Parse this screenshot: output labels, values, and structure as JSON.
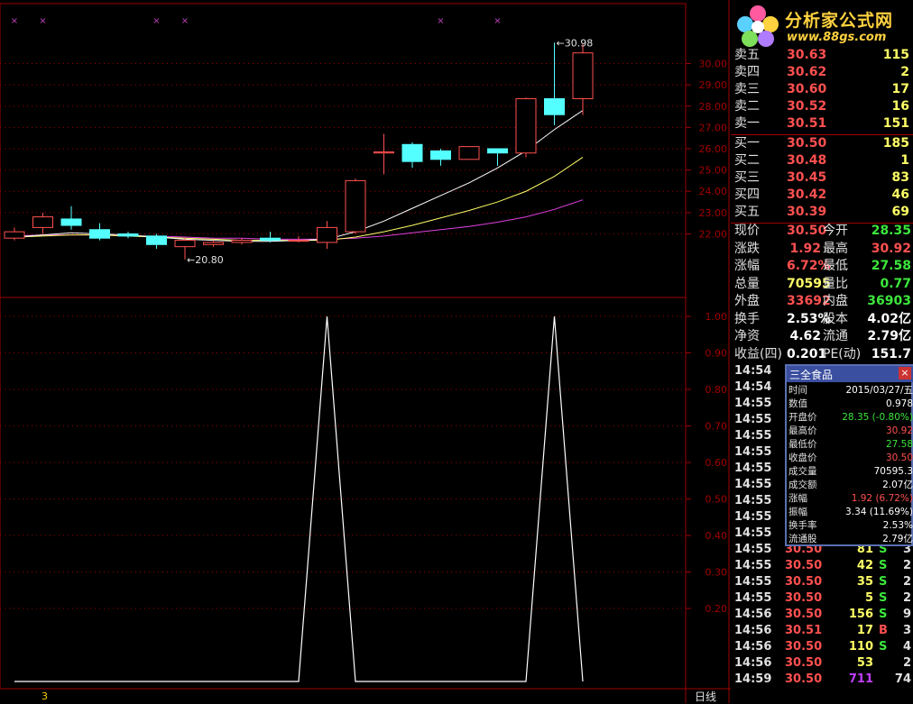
{
  "logo": {
    "title": "分析家公式网",
    "url": "www.88gs.com"
  },
  "colors": {
    "up": "#ff5050",
    "down": "#54ffff",
    "ma5": "#ffffff",
    "ma10": "#ffff66",
    "ma20": "#e040e0",
    "grid": "#a00000",
    "indicator": "#ffffff"
  },
  "chart_data": [
    {
      "type": "candlestick",
      "y_ticks": [
        "30.00",
        "29.00",
        "28.00",
        "27.00",
        "26.00",
        "25.00",
        "24.00",
        "23.00",
        "22.00"
      ],
      "ylim": [
        20.2,
        31.8
      ],
      "annotations": [
        {
          "label": "30.98",
          "x_index": 19,
          "y": 30.98
        },
        {
          "label": "20.80",
          "x_index": 6,
          "y": 20.8
        }
      ],
      "candles": [
        {
          "o": 21.8,
          "h": 22.3,
          "l": 21.7,
          "c": 22.1
        },
        {
          "o": 22.3,
          "h": 23.0,
          "l": 22.0,
          "c": 22.8
        },
        {
          "o": 22.7,
          "h": 23.3,
          "l": 22.2,
          "c": 22.4
        },
        {
          "o": 22.2,
          "h": 22.5,
          "l": 21.7,
          "c": 21.8
        },
        {
          "o": 22.0,
          "h": 22.1,
          "l": 21.8,
          "c": 21.9
        },
        {
          "o": 21.9,
          "h": 22.0,
          "l": 21.3,
          "c": 21.5
        },
        {
          "o": 21.4,
          "h": 21.8,
          "l": 20.8,
          "c": 21.7
        },
        {
          "o": 21.5,
          "h": 21.7,
          "l": 21.4,
          "c": 21.6
        },
        {
          "o": 21.6,
          "h": 21.8,
          "l": 21.5,
          "c": 21.7
        },
        {
          "o": 21.8,
          "h": 22.1,
          "l": 21.6,
          "c": 21.7
        },
        {
          "o": 21.7,
          "h": 21.9,
          "l": 21.6,
          "c": 21.7
        },
        {
          "o": 21.6,
          "h": 22.6,
          "l": 21.3,
          "c": 22.3
        },
        {
          "o": 22.1,
          "h": 24.6,
          "l": 22.0,
          "c": 24.5
        },
        {
          "o": 25.8,
          "h": 26.7,
          "l": 24.8,
          "c": 25.85
        },
        {
          "o": 26.2,
          "h": 26.3,
          "l": 25.1,
          "c": 25.4
        },
        {
          "o": 25.9,
          "h": 26.0,
          "l": 25.2,
          "c": 25.5
        },
        {
          "o": 25.5,
          "h": 26.1,
          "l": 25.5,
          "c": 26.1
        },
        {
          "o": 26.0,
          "h": 26.0,
          "l": 25.2,
          "c": 25.8
        },
        {
          "o": 25.8,
          "h": 28.4,
          "l": 25.6,
          "c": 28.35
        },
        {
          "o": 28.35,
          "h": 30.98,
          "l": 27.1,
          "c": 27.6
        },
        {
          "o": 28.35,
          "h": 30.92,
          "l": 27.58,
          "c": 30.5
        }
      ],
      "ma5": [
        21.85,
        21.95,
        22.05,
        22.0,
        21.95,
        21.85,
        21.75,
        21.7,
        21.65,
        21.65,
        21.7,
        21.75,
        22.1,
        22.6,
        23.2,
        23.8,
        24.4,
        25.1,
        25.9,
        26.9,
        27.8
      ],
      "ma10": [
        21.85,
        21.9,
        21.95,
        21.95,
        21.9,
        21.85,
        21.8,
        21.75,
        21.7,
        21.7,
        21.7,
        21.7,
        21.85,
        22.1,
        22.4,
        22.75,
        23.1,
        23.5,
        24.0,
        24.7,
        25.6
      ],
      "ma20": [
        21.9,
        21.95,
        21.95,
        21.95,
        21.9,
        21.9,
        21.85,
        21.8,
        21.8,
        21.75,
        21.75,
        21.75,
        21.8,
        21.9,
        22.05,
        22.2,
        22.35,
        22.55,
        22.8,
        23.15,
        23.6
      ],
      "markers": [
        0,
        1,
        5,
        6,
        15,
        17
      ]
    },
    {
      "type": "line",
      "y_ticks": [
        "1.00",
        "0.90",
        "0.80",
        "0.70",
        "0.60",
        "0.50",
        "0.40",
        "0.30",
        "0.20"
      ],
      "ylim": [
        0.0,
        1.0
      ],
      "values": [
        0,
        0,
        0,
        0,
        0,
        0,
        0,
        0,
        0,
        0,
        0,
        1,
        0,
        0,
        0,
        0,
        0,
        0,
        0,
        1,
        0
      ]
    }
  ],
  "bottom": {
    "left": "3",
    "right": "日线"
  },
  "quotes": {
    "asks": [
      {
        "label": "卖五",
        "price": "30.63",
        "vol": "115"
      },
      {
        "label": "卖四",
        "price": "30.62",
        "vol": "2"
      },
      {
        "label": "卖三",
        "price": "30.60",
        "vol": "17"
      },
      {
        "label": "卖二",
        "price": "30.52",
        "vol": "16"
      },
      {
        "label": "卖一",
        "price": "30.51",
        "vol": "151"
      }
    ],
    "bids": [
      {
        "label": "买一",
        "price": "30.50",
        "vol": "185"
      },
      {
        "label": "买二",
        "price": "30.48",
        "vol": "1"
      },
      {
        "label": "买三",
        "price": "30.45",
        "vol": "83"
      },
      {
        "label": "买四",
        "price": "30.42",
        "vol": "46"
      },
      {
        "label": "买五",
        "price": "30.39",
        "vol": "69"
      }
    ]
  },
  "stats": [
    {
      "k1": "现价",
      "v1": "30.50",
      "c1": "red",
      "k2": "今开",
      "v2": "28.35",
      "c2": "green"
    },
    {
      "k1": "涨跌",
      "v1": "1.92",
      "c1": "red",
      "k2": "最高",
      "v2": "30.92",
      "c2": "red"
    },
    {
      "k1": "涨幅",
      "v1": "6.72%",
      "c1": "red",
      "k2": "最低",
      "v2": "27.58",
      "c2": "green"
    },
    {
      "k1": "总量",
      "v1": "70595",
      "c1": "yellow",
      "k2": "量比",
      "v2": "0.77",
      "c2": "green"
    },
    {
      "k1": "外盘",
      "v1": "33692",
      "c1": "red",
      "k2": "内盘",
      "v2": "36903",
      "c2": "green"
    },
    {
      "k1": "换手",
      "v1": "2.53%",
      "c1": "white",
      "k2": "股本",
      "v2": "4.02亿",
      "c2": "white"
    },
    {
      "k1": "净资",
      "v1": "4.62",
      "c1": "white",
      "k2": "流通",
      "v2": "2.79亿",
      "c2": "white"
    },
    {
      "k1": "收益(四)",
      "v1": "0.201",
      "c1": "white",
      "k2": "PE(动)",
      "v2": "151.7",
      "c2": "white"
    }
  ],
  "ticks": [
    {
      "t": "14:54"
    },
    {
      "t": "14:54"
    },
    {
      "t": "14:55"
    },
    {
      "t": "14:55"
    },
    {
      "t": "14:55"
    },
    {
      "t": "14:55"
    },
    {
      "t": "14:55"
    },
    {
      "t": "14:55"
    },
    {
      "t": "14:55"
    },
    {
      "t": "14:55"
    },
    {
      "t": "14:55",
      "p": "30.51",
      "v": "6",
      "s": "B",
      "n": "2"
    },
    {
      "t": "14:55",
      "p": "30.50",
      "v": "81",
      "s": "S",
      "n": "3"
    },
    {
      "t": "14:55",
      "p": "30.50",
      "v": "42",
      "s": "S",
      "n": "2"
    },
    {
      "t": "14:55",
      "p": "30.50",
      "v": "35",
      "s": "S",
      "n": "2"
    },
    {
      "t": "14:55",
      "p": "30.50",
      "v": "5",
      "s": "S",
      "n": "2"
    },
    {
      "t": "14:56",
      "p": "30.50",
      "v": "156",
      "s": "S",
      "n": "9"
    },
    {
      "t": "14:56",
      "p": "30.51",
      "v": "17",
      "s": "B",
      "n": "3"
    },
    {
      "t": "14:56",
      "p": "30.50",
      "v": "110",
      "s": "S",
      "n": "4"
    },
    {
      "t": "14:56",
      "p": "30.50",
      "v": "53",
      "s": "",
      "n": "2"
    },
    {
      "t": "14:59",
      "p": "30.50",
      "v": "711",
      "s": "",
      "n": "74"
    }
  ],
  "popup": {
    "title": "三全食品",
    "close": "×",
    "rows": [
      {
        "k": "时间",
        "v": "2015/03/27/五",
        "c": "white"
      },
      {
        "k": "数值",
        "v": "0.978",
        "c": "white"
      },
      {
        "k": "开盘价",
        "v": "28.35 (-0.80%)",
        "c": "green"
      },
      {
        "k": "最高价",
        "v": "30.92",
        "c": "red"
      },
      {
        "k": "最低价",
        "v": "27.58",
        "c": "green"
      },
      {
        "k": "收盘价",
        "v": "30.50",
        "c": "red"
      },
      {
        "k": "成交量",
        "v": "70595.3",
        "c": "white"
      },
      {
        "k": "成交额",
        "v": "2.07亿",
        "c": "white"
      },
      {
        "k": "涨幅",
        "v": "1.92 (6.72%)",
        "c": "red"
      },
      {
        "k": "振幅",
        "v": "3.34 (11.69%)",
        "c": "white"
      },
      {
        "k": "换手率",
        "v": "2.53%",
        "c": "white"
      },
      {
        "k": "流通股",
        "v": "2.79亿",
        "c": "white"
      }
    ]
  }
}
